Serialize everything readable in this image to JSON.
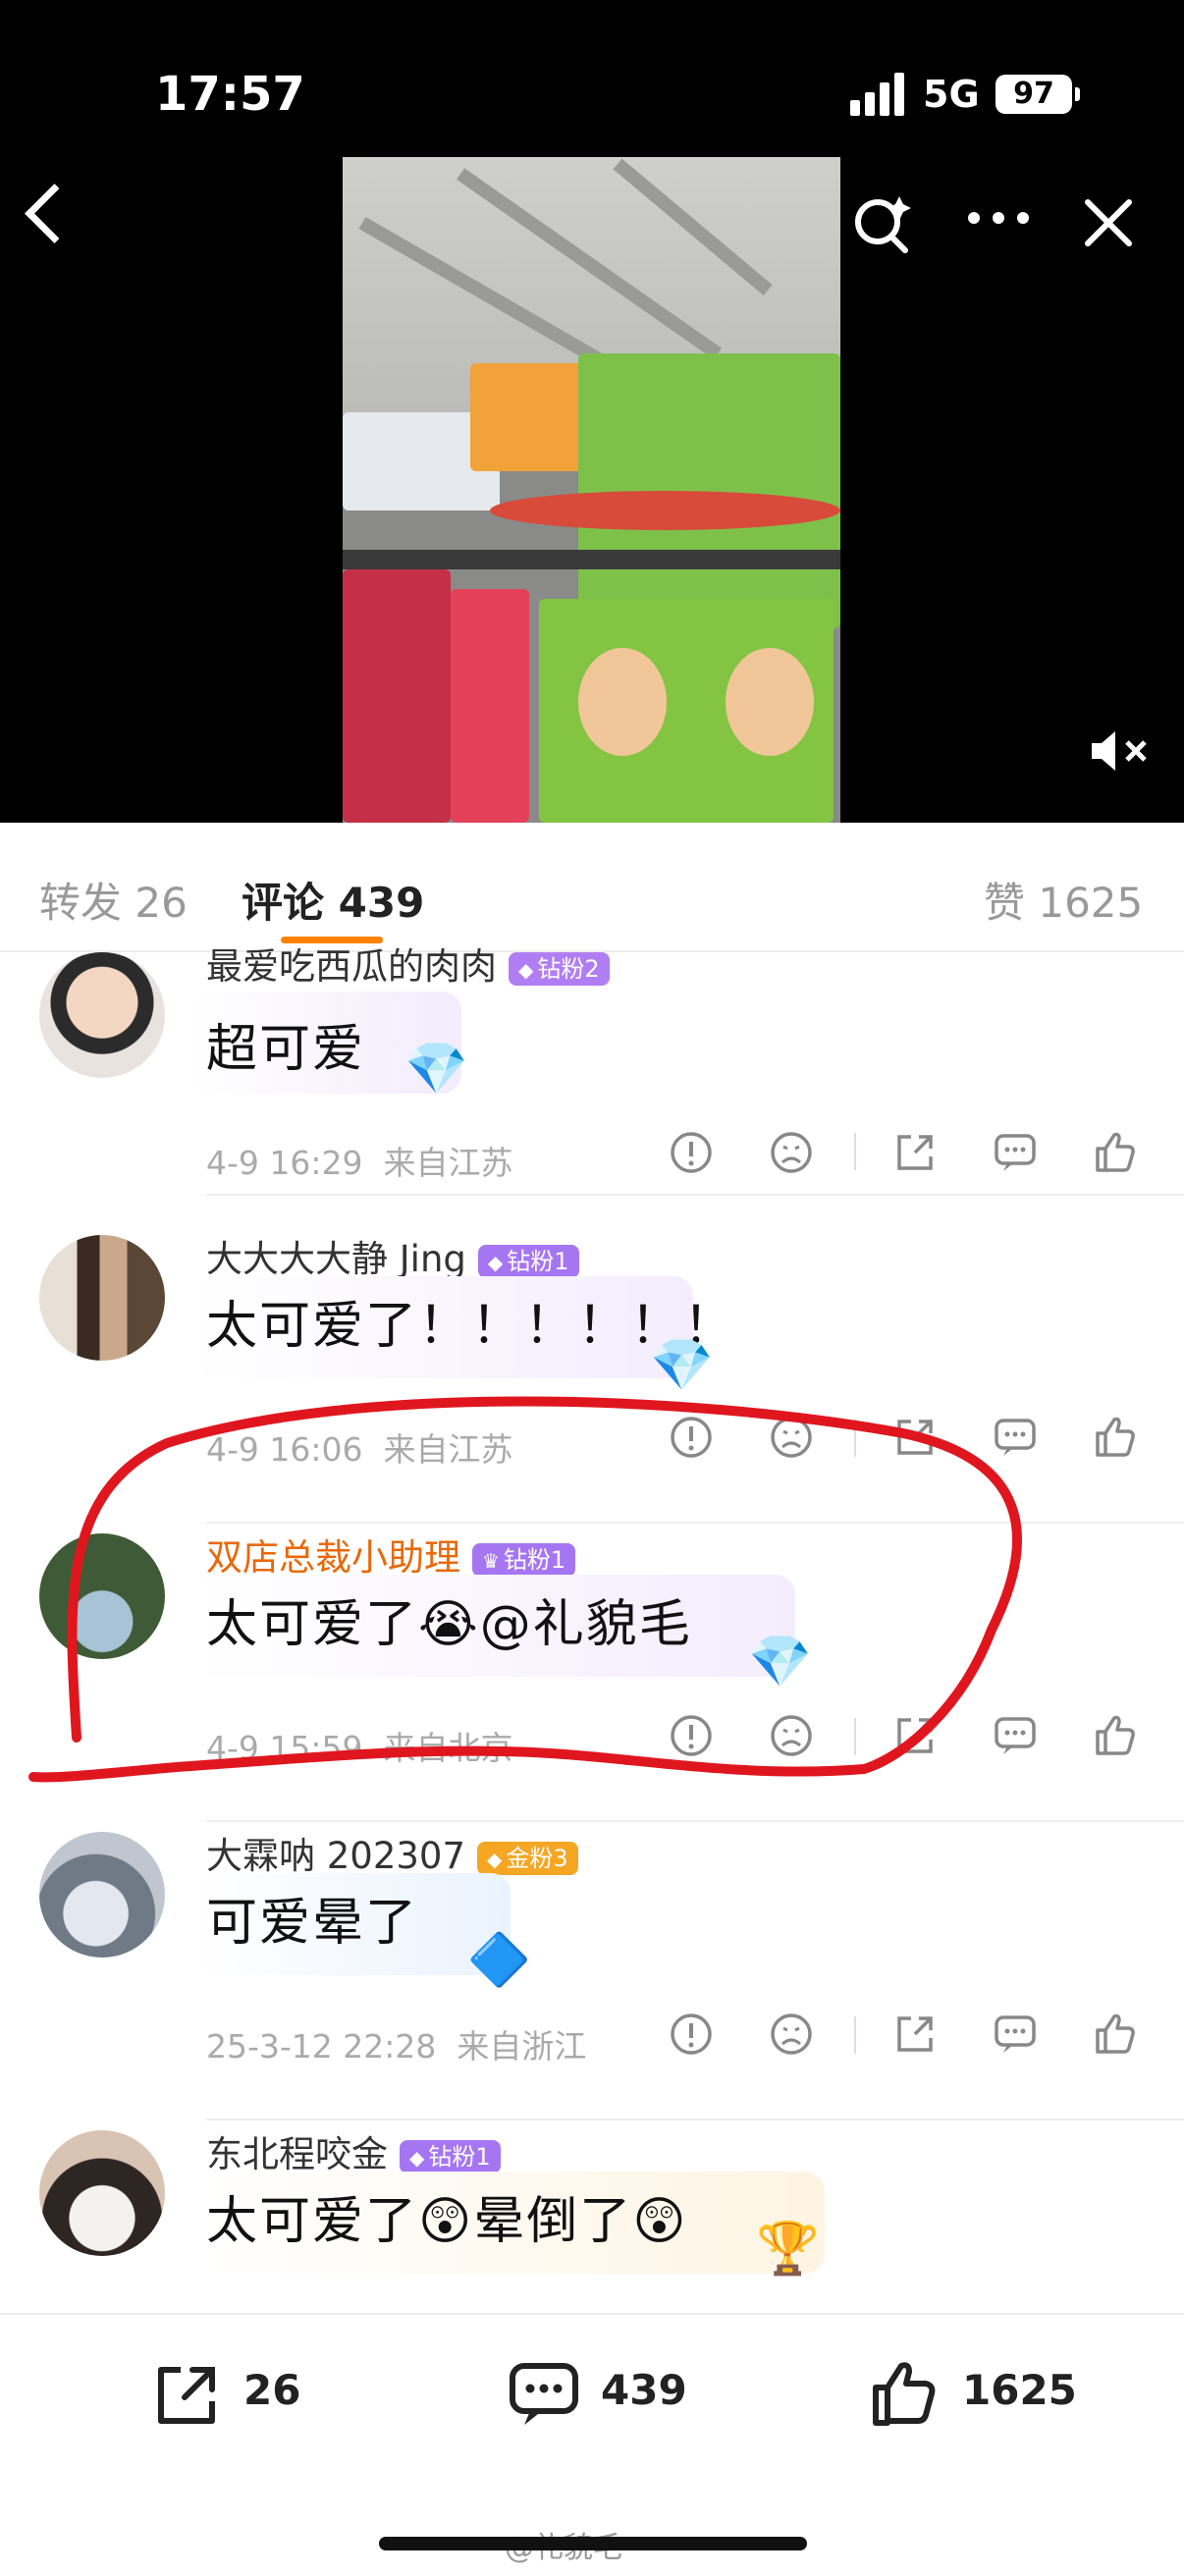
{
  "status_bar": {
    "time": "17:57",
    "network": "5G",
    "battery": "97"
  },
  "video": {
    "mute_label": "◀×"
  },
  "tabs": [
    {
      "label": "转发 26"
    },
    {
      "label": "评论 439"
    },
    {
      "label": "赞 1625"
    }
  ],
  "comments": [
    {
      "username": "最爱吃西瓜的肉肉",
      "badge": "钻粉2",
      "text": "超可爱",
      "gem": "💎",
      "time": "4-9 16:29",
      "location": "来自江苏"
    },
    {
      "username": "大大大大静 Jing",
      "badge": "钻粉1",
      "text": "太可爱了！！！！！！",
      "gem": "💎",
      "time": "4-9 16:06",
      "location": "来自江苏"
    },
    {
      "username": "双店总裁小助理",
      "badge": "钻粉1",
      "text": "太可爱了😭@礼貌毛",
      "gem": "💎",
      "time": "4-9 15:59",
      "location": "来自北京"
    },
    {
      "username": "大霖呐 202307",
      "badge": "金粉3",
      "text": "可爱晕了",
      "gem": "🔷",
      "time": "25-3-12 22:28",
      "location": "来自浙江"
    },
    {
      "username": "东北程咬金",
      "badge": "钻粉1",
      "text": "太可爱了😲晕倒了😲",
      "gem": "🏆",
      "time": "",
      "location": ""
    }
  ],
  "bottom_bar": {
    "repost_count": "26",
    "comment_count": "439",
    "like_count": "1625"
  },
  "watermark": "@礼貌毛",
  "colors": {
    "accent": "#ff8200",
    "vip_name": "#e8690c",
    "diamond_badge": "#9b6cf0",
    "gold_badge": "#f5a623",
    "annotation": "#e0161e"
  }
}
